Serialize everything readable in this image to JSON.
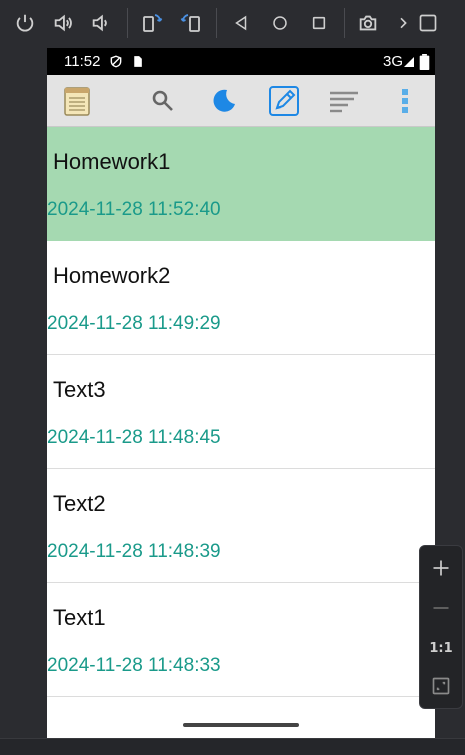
{
  "status_bar": {
    "time": "11:52",
    "network": "3G"
  },
  "notes": [
    {
      "title": "Homework1",
      "date": "2024-11-28 11:52:40",
      "selected": true
    },
    {
      "title": "Homework2",
      "date": "2024-11-28 11:49:29",
      "selected": false
    },
    {
      "title": "Text3",
      "date": "2024-11-28 11:48:45",
      "selected": false
    },
    {
      "title": "Text2",
      "date": "2024-11-28 11:48:39",
      "selected": false
    },
    {
      "title": "Text1",
      "date": "2024-11-28 11:48:33",
      "selected": false
    }
  ],
  "zoom_panel": {
    "actual_size_label": "1:1"
  },
  "colors": {
    "selected_row": "#a5d9b1",
    "date_text": "#1a9a8a",
    "accent_blue": "#1e88e5"
  },
  "icons": {
    "emulator_toolbar": [
      "power-icon",
      "volume-up-icon",
      "volume-down-icon",
      "rotate-left-icon",
      "rotate-right-icon",
      "back-icon",
      "home-icon",
      "overview-icon",
      "screenshot-icon",
      "more-icon"
    ],
    "app_toolbar": [
      "notes-icon",
      "search-icon",
      "night-mode-icon",
      "edit-icon",
      "sort-icon",
      "overflow-menu-icon"
    ]
  }
}
